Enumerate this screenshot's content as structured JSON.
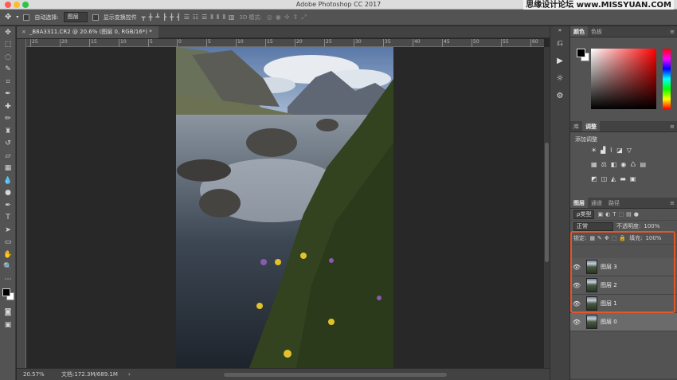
{
  "titlebar": {
    "title": "Adobe Photoshop CC 2017",
    "watermark": "思缘设计论坛 www.MISSYUAN.COM"
  },
  "optbar": {
    "move_icon": "move-icon",
    "auto_select_label": "自动选择:",
    "auto_select_value": "图层",
    "show_transform_label": "显示变换控件",
    "mode3d_label": "3D 模式:"
  },
  "document": {
    "tab_label": "_B8A3311.CR2 @ 20.6% (图层 0, RGB/16*) *",
    "close_symbol": "×"
  },
  "ruler": {
    "ticks": [
      "25",
      "20",
      "15",
      "10",
      "5",
      "0",
      "5",
      "10",
      "15",
      "20",
      "25",
      "30",
      "35",
      "40",
      "45",
      "50",
      "55",
      "60"
    ]
  },
  "status": {
    "zoom": "20.57%",
    "doc_size": "文档:172.3M/689.1M",
    "arrow": "›"
  },
  "color_panel": {
    "tabs": [
      "颜色",
      "色板"
    ]
  },
  "adjust_panel": {
    "tabs": [
      "库",
      "调整"
    ],
    "title": "添加调整"
  },
  "layers_panel": {
    "tabs": [
      "图层",
      "通道",
      "路径"
    ],
    "filter_kind": "ρ类型",
    "blend_mode": "正常",
    "opacity_label": "不透明度:",
    "opacity_value": "100%",
    "lock_label": "锁定:",
    "fill_label": "填充:",
    "fill_value": "100%",
    "layers": [
      {
        "name": "图层 3",
        "selected": false
      },
      {
        "name": "图层 2",
        "selected": false
      },
      {
        "name": "图层 1",
        "selected": false
      },
      {
        "name": "图层 0",
        "selected": true
      }
    ],
    "highlight_color": "#e2572a"
  },
  "colors": {
    "ui_dark": "#282828",
    "ui_panel": "#535353",
    "highlight": "#e2572a"
  }
}
